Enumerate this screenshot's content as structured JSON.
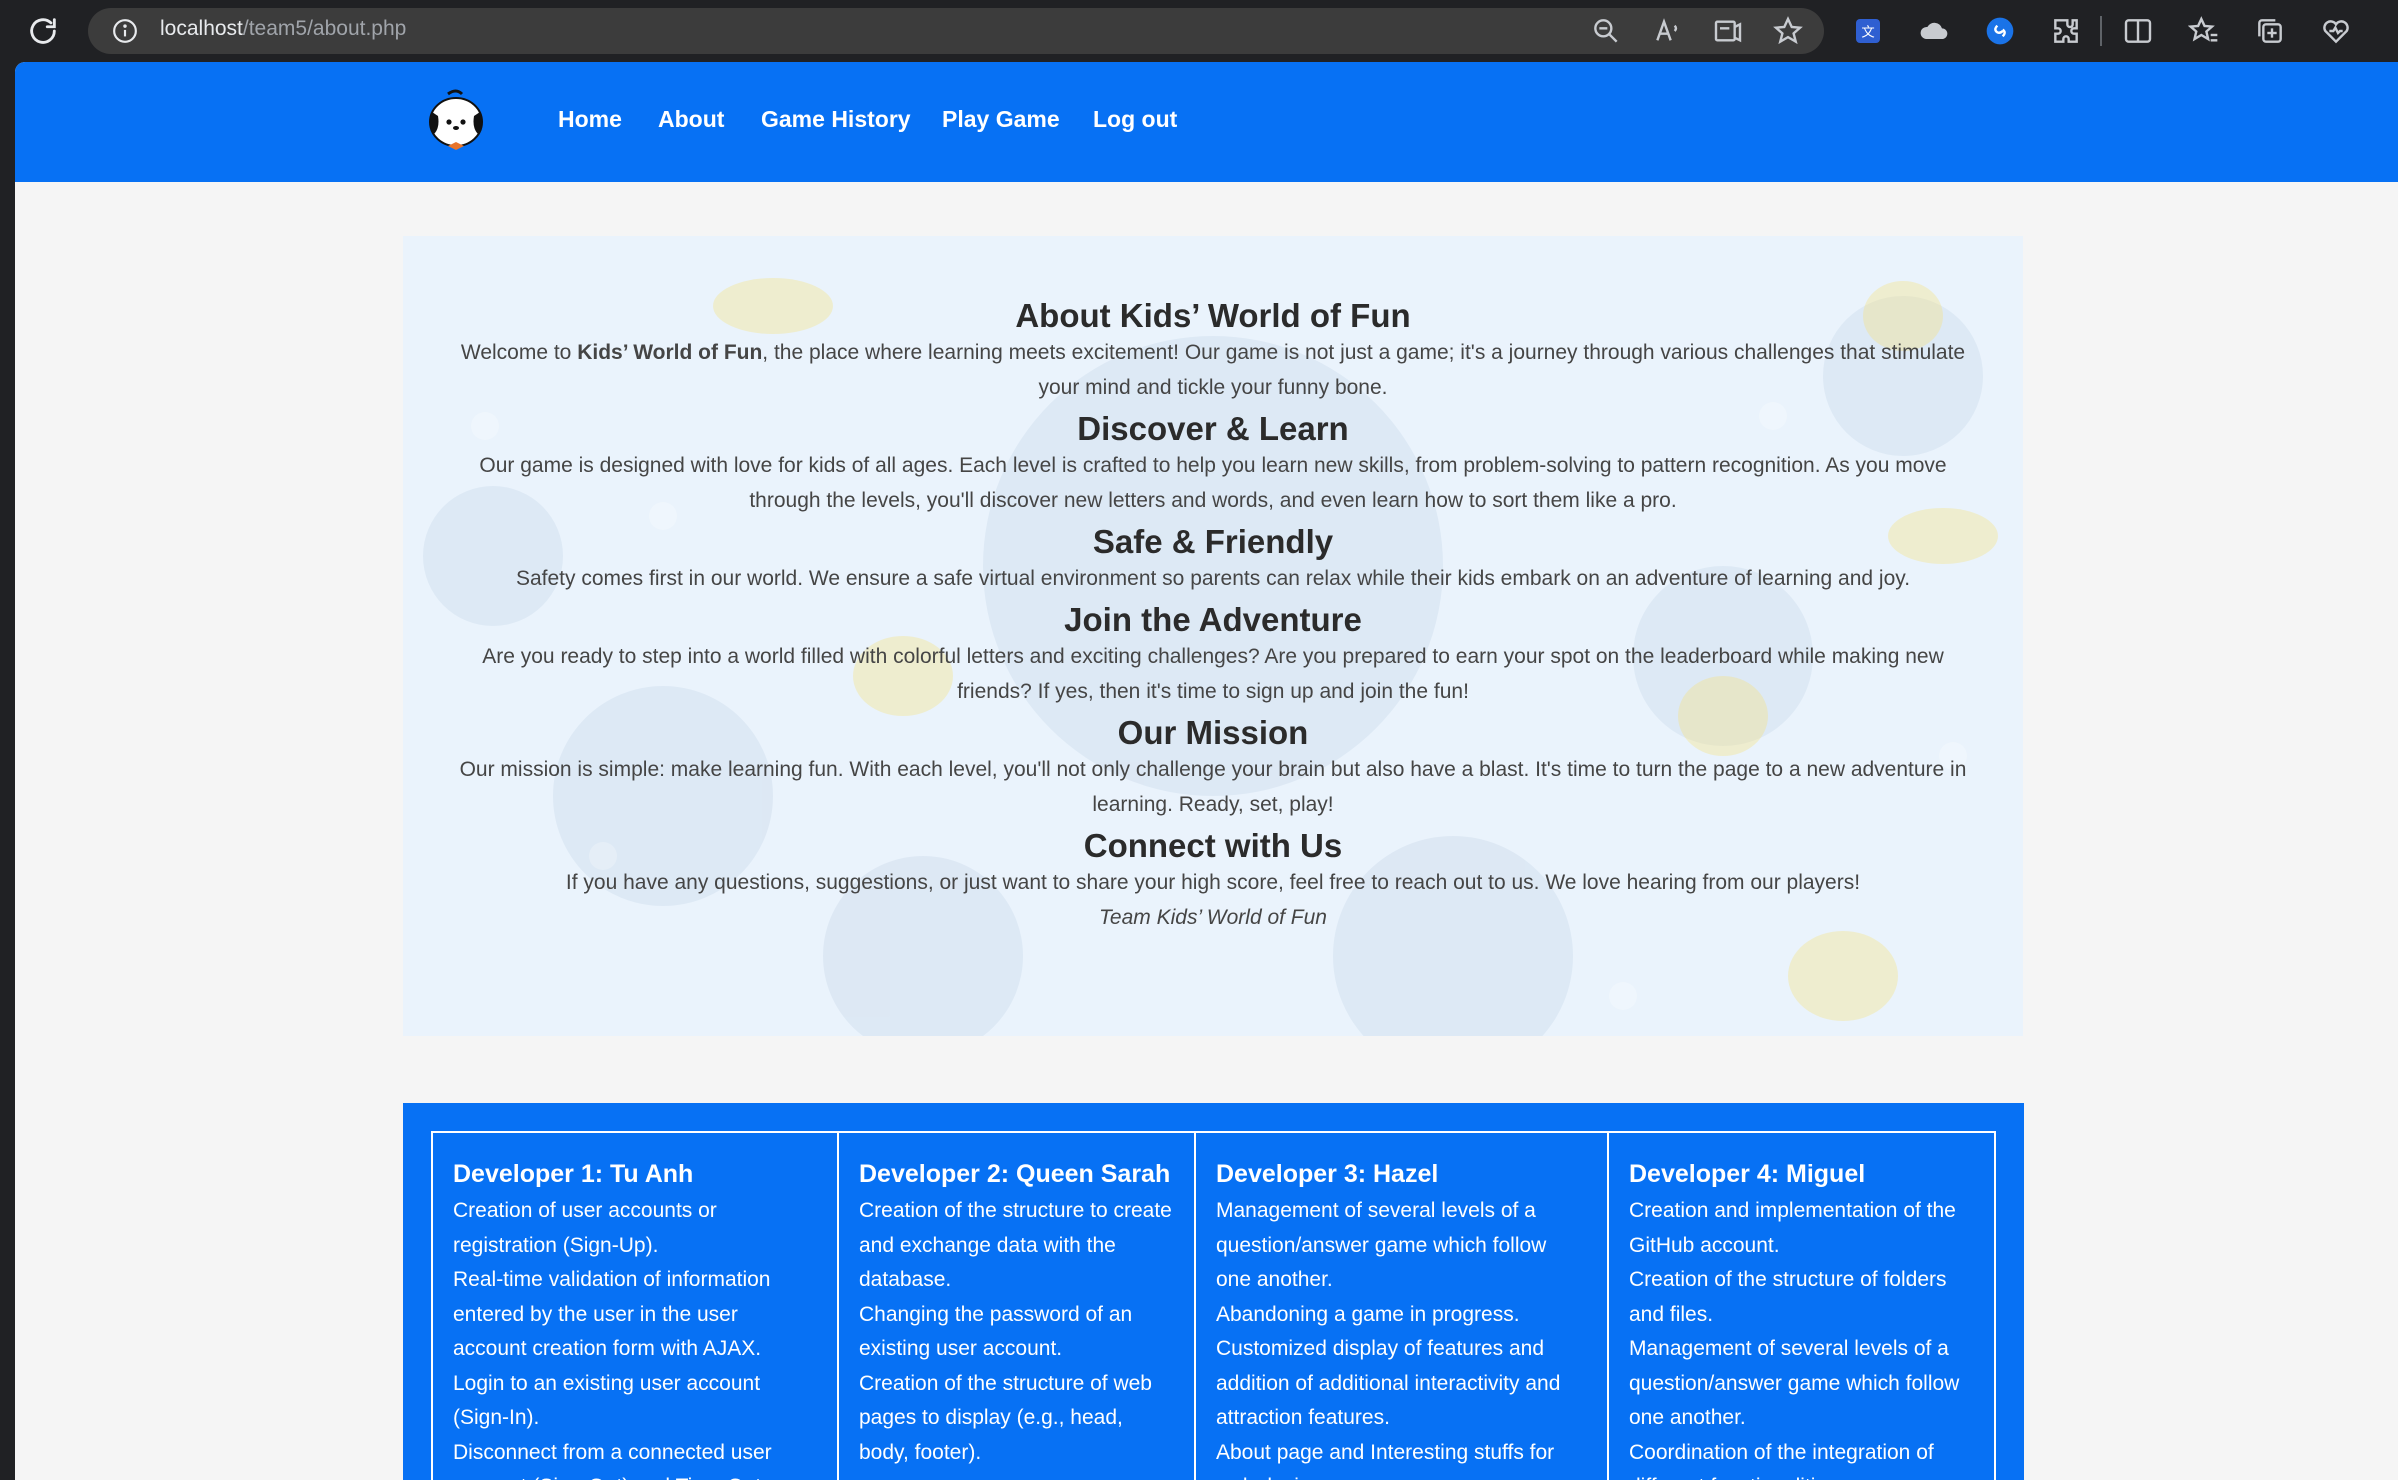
{
  "browser": {
    "url_host": "localhost",
    "url_path": "/team5/about.php",
    "icons": [
      "reload-icon",
      "info-icon",
      "zoom-out-icon",
      "read-aloud-icon",
      "immersive-reader-icon",
      "favorite-star-icon",
      "translate-extension-icon",
      "cloud-extension-icon",
      "shazam-extension-icon",
      "extensions-icon",
      "split-screen-icon",
      "favorites-icon",
      "collections-icon",
      "browser-essentials-icon"
    ]
  },
  "nav": {
    "links": [
      "Home",
      "About",
      "Game History",
      "Play Game",
      "Log out"
    ]
  },
  "about": {
    "title": "About Kids’ World of Fun",
    "intro_before": "Welcome to ",
    "intro_bold": "Kids’ World of Fun",
    "intro_after": ", the place where learning meets excitement! Our game is not just a game; it's a journey through various challenges that stimulate your mind and tickle your funny bone.",
    "sections": [
      {
        "heading": "Discover & Learn",
        "text": "Our game is designed with love for kids of all ages. Each level is crafted to help you learn new skills, from problem-solving to pattern recognition. As you move through the levels, you'll discover new letters and words, and even learn how to sort them like a pro."
      },
      {
        "heading": "Safe & Friendly",
        "text": "Safety comes first in our world. We ensure a safe virtual environment so parents can relax while their kids embark on an adventure of learning and joy."
      },
      {
        "heading": "Join the Adventure",
        "text": "Are you ready to step into a world filled with colorful letters and exciting challenges? Are you prepared to earn your spot on the leaderboard while making new friends? If yes, then it's time to sign up and join the fun!"
      },
      {
        "heading": "Our Mission",
        "text": "Our mission is simple: make learning fun. With each level, you'll not only challenge your brain but also have a blast. It's time to turn the page to a new adventure in learning. Ready, set, play!"
      },
      {
        "heading": "Connect with Us",
        "text": "If you have any questions, suggestions, or just want to share your high score, feel free to reach out to us. We love hearing from our players!"
      }
    ],
    "signature": "Team Kids’ World of Fun"
  },
  "developers": [
    {
      "name": "Developer 1: Tu Anh",
      "tasks": [
        "Creation of user accounts or registration (Sign-Up).",
        "Real-time validation of information entered by the user in the user account creation form with AJAX.",
        "Login to an existing user account (Sign-In).",
        "Disconnect from a connected user account (Sign-Out) and Time Out"
      ]
    },
    {
      "name": "Developer 2: Queen Sarah",
      "tasks": [
        "Creation of the structure to create and exchange data with the database.",
        "Changing the password of an existing user account.",
        "Creation of the structure of web pages to display (e.g., head, body, footer)."
      ]
    },
    {
      "name": "Developer 3: Hazel",
      "tasks": [
        "Management of several levels of a question/answer game which follow one another.",
        "Abandoning a game in progress.",
        "Customized display of features and addition of additional interactivity and attraction features.",
        "About page and Interesting stuffs for web design."
      ]
    },
    {
      "name": "Developer 4: Miguel",
      "tasks": [
        "Creation and implementation of the GitHub account.",
        "Creation of the structure of folders and files.",
        "Management of several levels of a question/answer game which follow one another.",
        "Coordination of the integration of different functionalities."
      ]
    }
  ],
  "colors": {
    "accent_blue": "#0771f4",
    "page_bg": "#f5f5f5",
    "card_bg": "#eaf3fc"
  }
}
